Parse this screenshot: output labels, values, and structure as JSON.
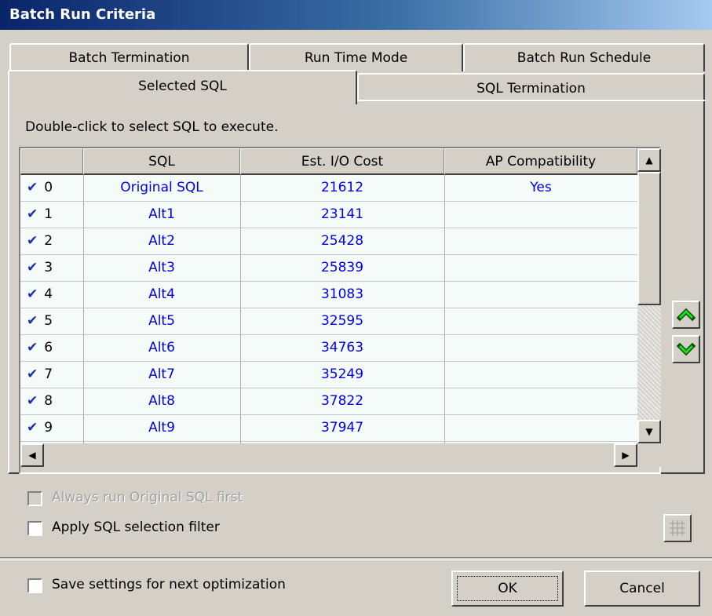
{
  "window": {
    "title": "Batch Run Criteria"
  },
  "tabs": {
    "row1": [
      "Batch Termination",
      "Run Time Mode",
      "Batch Run Schedule"
    ],
    "row2": [
      "Selected SQL",
      "SQL Termination"
    ],
    "selected": "Selected SQL"
  },
  "instruction": "Double-click to select SQL to execute.",
  "grid": {
    "columns": [
      "",
      "SQL",
      "Est. I/O Cost",
      "AP Compatibility"
    ],
    "rows": [
      {
        "index": "0",
        "checked": true,
        "sql": "Original SQL",
        "cost": "21612",
        "ap": "Yes"
      },
      {
        "index": "1",
        "checked": true,
        "sql": "Alt1",
        "cost": "23141",
        "ap": ""
      },
      {
        "index": "2",
        "checked": true,
        "sql": "Alt2",
        "cost": "25428",
        "ap": ""
      },
      {
        "index": "3",
        "checked": true,
        "sql": "Alt3",
        "cost": "25839",
        "ap": ""
      },
      {
        "index": "4",
        "checked": true,
        "sql": "Alt4",
        "cost": "31083",
        "ap": ""
      },
      {
        "index": "5",
        "checked": true,
        "sql": "Alt5",
        "cost": "32595",
        "ap": ""
      },
      {
        "index": "6",
        "checked": true,
        "sql": "Alt6",
        "cost": "34763",
        "ap": ""
      },
      {
        "index": "7",
        "checked": true,
        "sql": "Alt7",
        "cost": "35249",
        "ap": ""
      },
      {
        "index": "8",
        "checked": true,
        "sql": "Alt8",
        "cost": "37822",
        "ap": ""
      },
      {
        "index": "9",
        "checked": true,
        "sql": "Alt9",
        "cost": "37947",
        "ap": ""
      }
    ]
  },
  "options": {
    "always_run_original": "Always run Original SQL first",
    "apply_filter": "Apply SQL selection filter",
    "save_settings": "Save settings for next optimization"
  },
  "buttons": {
    "ok": "OK",
    "cancel": "Cancel"
  },
  "colors": {
    "cell_text": "#0000e0",
    "arrow_green": "#00a000",
    "title_start": "#0a246a"
  }
}
